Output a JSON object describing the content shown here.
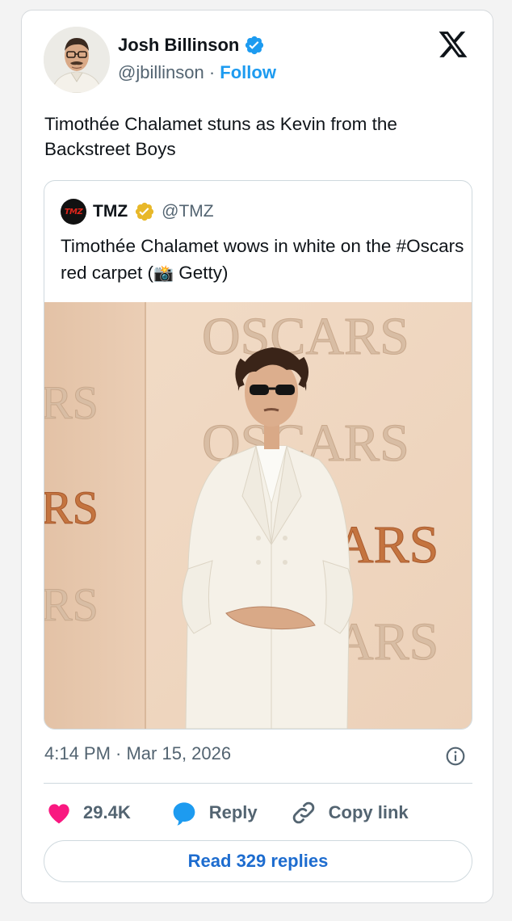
{
  "tweet": {
    "author_name": "Josh Billinson",
    "author_handle": "@jbillinson",
    "separator": "·",
    "follow_label": "Follow",
    "text": "Timothée Chalamet stuns as Kevin from the Backstreet Boys",
    "timestamp": "4:14 PM · Mar 15, 2026",
    "verified_color": "#1d9bf0"
  },
  "quoted": {
    "logo_text": "TMZ",
    "name": "TMZ",
    "handle": "@TMZ",
    "text_before": "Timothée Chalamet wows in white on the #Oscars red carpet (",
    "camera_glyph": "📸",
    "text_after": " Getty)",
    "verified_color": "#e8b829",
    "photo_backdrop_text": [
      "OSCARS",
      "RS",
      "OSCARS",
      "RS",
      "ARS",
      "RS",
      "ARS"
    ]
  },
  "actions": {
    "likes": "29.4K",
    "reply_label": "Reply",
    "copy_link_label": "Copy link",
    "like_color": "#f91880",
    "reply_color": "#1d9bf0"
  },
  "read_replies_label": "Read 329 replies",
  "icons": [
    "verified-badge-icon",
    "x-logo-icon",
    "info-icon",
    "heart-icon",
    "reply-bubble-icon",
    "link-icon"
  ]
}
